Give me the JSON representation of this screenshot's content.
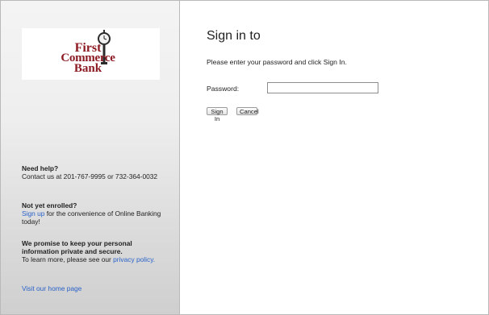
{
  "sidebar": {
    "logo": {
      "line1": "First",
      "line2": "Commerce",
      "line3": "Bank",
      "brand_color": "#8c1a22",
      "icon": "clock-icon"
    },
    "help": {
      "heading": "Need help?",
      "text": "Contact us at 201-767-9995 or 732-364-0032"
    },
    "enroll": {
      "heading": "Not yet enrolled?",
      "link": "Sign up",
      "text": " for the convenience of Online Banking today!"
    },
    "privacy": {
      "heading": "We promise to keep your personal information private and secure.",
      "text": "To learn more, please see our ",
      "link": "privacy policy."
    },
    "home_link": "Visit our home page"
  },
  "main": {
    "title": "Sign in to",
    "instructions": "Please enter your password and click Sign In.",
    "password_label": "Password:",
    "password_value": "",
    "signin_label": "Sign In",
    "cancel_label": "Cancel"
  },
  "colors": {
    "link": "#2a62c8",
    "border": "#b9b9b9"
  }
}
